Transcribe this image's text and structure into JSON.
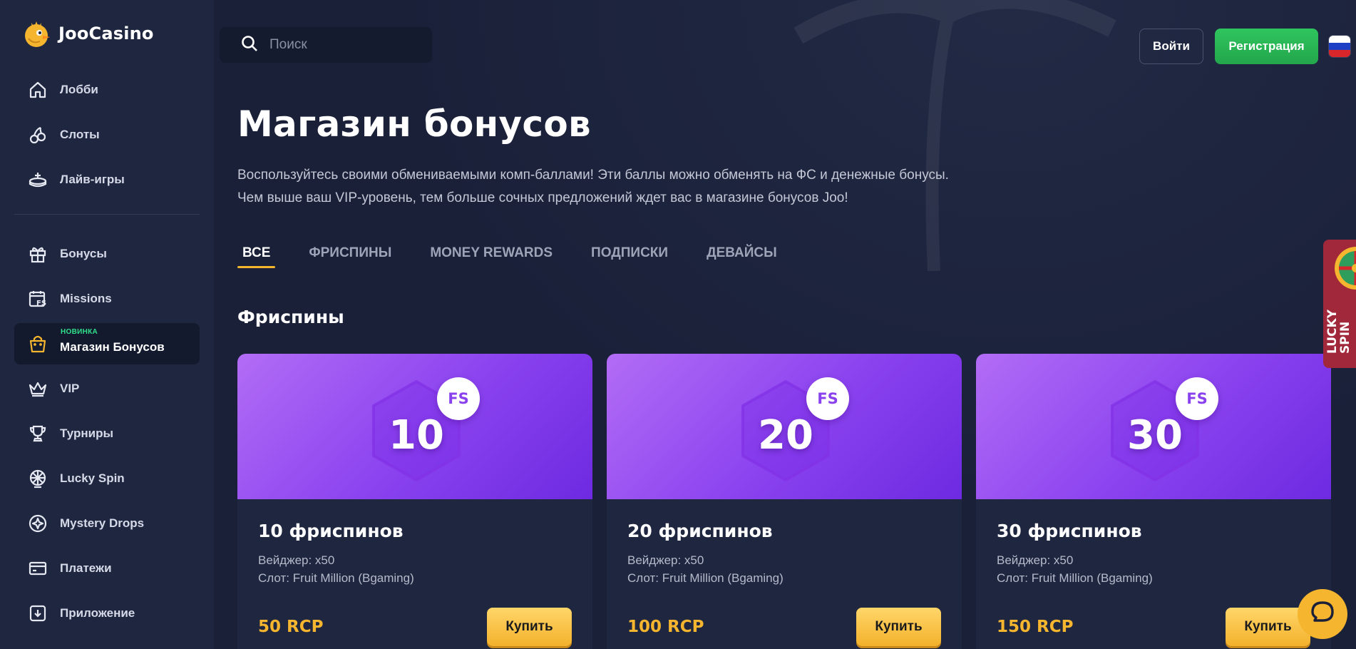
{
  "app": {
    "logo_text": "JooCasino"
  },
  "sidebar": {
    "items": [
      {
        "label": "Лобби",
        "icon": "home-icon"
      },
      {
        "label": "Слоты",
        "icon": "cherries-icon"
      },
      {
        "label": "Лайв-игры",
        "icon": "live-table-icon"
      },
      {
        "label": "Бонусы",
        "icon": "gift-icon"
      },
      {
        "label": "Missions",
        "icon": "calendar-fs-icon"
      },
      {
        "label": "Магазин Бонусов",
        "icon": "shopping-bag-icon",
        "badge": "НОВИНКА",
        "active": true
      },
      {
        "label": "VIP",
        "icon": "crown-icon"
      },
      {
        "label": "Турниры",
        "icon": "trophy-icon"
      },
      {
        "label": "Lucky Spin",
        "icon": "wheel-icon"
      },
      {
        "label": "Mystery Drops",
        "icon": "mystery-drop-icon"
      },
      {
        "label": "Платежи",
        "icon": "card-icon"
      },
      {
        "label": "Приложение",
        "icon": "download-icon"
      }
    ]
  },
  "header": {
    "search_placeholder": "Поиск",
    "login_label": "Войти",
    "register_label": "Регистрация",
    "language_flag": "ru-flag-icon"
  },
  "page": {
    "title": "Магазин бонусов",
    "description_line1": "Воспользуйтесь своими обмениваемыми комп-баллами! Эти баллы можно обменять на ФС и денежные бонусы.",
    "description_line2": "Чем выше ваш VIP-уровень, тем больше сочных предложений ждет вас в магазине бонусов Joo!",
    "tabs": [
      "ВСЕ",
      "ФРИСПИНЫ",
      "MONEY REWARDS",
      "ПОДПИСКИ",
      "ДЕВАЙСЫ"
    ],
    "active_tab": "ВСЕ",
    "section_title": "Фриспины"
  },
  "cards": [
    {
      "badge": "FS",
      "number": "10",
      "title": "10 фриспинов",
      "wager": "Вейджер: x50",
      "slot": "Слот: Fruit Million (Bgaming)",
      "price": "50 RCP",
      "buy_label": "Купить"
    },
    {
      "badge": "FS",
      "number": "20",
      "title": "20 фриспинов",
      "wager": "Вейджер: x50",
      "slot": "Слот: Fruit Million (Bgaming)",
      "price": "100 RCP",
      "buy_label": "Купить"
    },
    {
      "badge": "FS",
      "number": "30",
      "title": "30 фриспинов",
      "wager": "Вейджер: x50",
      "slot": "Слот: Fruit Million (Bgaming)",
      "price": "150 RCP",
      "buy_label": "Купить"
    }
  ],
  "lucky_spin_tab": {
    "line1": "LUCKY",
    "line2": "SPIN"
  },
  "colors": {
    "accent_gold": "#f5b52e",
    "card_purple": "#8a42ef",
    "register_green": "#2fc55d",
    "background": "#1a2038"
  }
}
